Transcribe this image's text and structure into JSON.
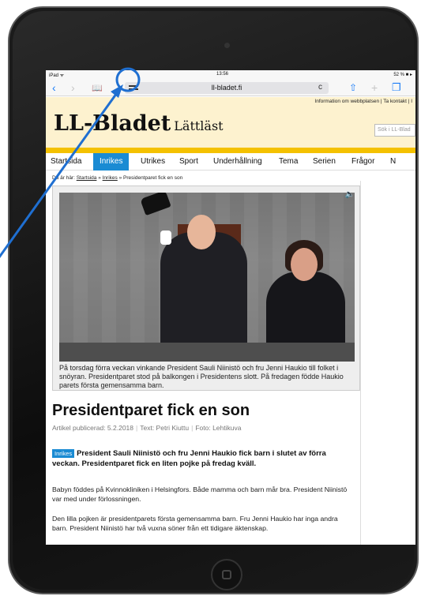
{
  "status": {
    "device": "iPad ᯤ",
    "time": "13:56",
    "battery": "52 % ■ ▸"
  },
  "browser": {
    "back": "‹",
    "forward": "›",
    "bookmarks": "📖",
    "reader": "",
    "url": "ll-bladet.fi",
    "reload": "c",
    "share": "⇧",
    "new_tab": "+",
    "tabs": "❐"
  },
  "site": {
    "info_links": "Information om webbplatsen | Ta kontakt | I",
    "logo": "LL-Bladet",
    "logo_sub": "Lättläst",
    "search_placeholder": "Sök i LL-Blad"
  },
  "nav": [
    "Startsida",
    "Inrikes",
    "Utrikes",
    "Sport",
    "Underhållning",
    "Tema",
    "Serien",
    "Frågor",
    "N"
  ],
  "nav_active": "Inrikes",
  "breadcrumb": {
    "prefix": "Du är här:",
    "home": "Startsida",
    "section": "Inrikes",
    "current": "Presidentparet fick en son",
    "sep": "»"
  },
  "figure": {
    "caption": "På torsdag förra veckan vinkande President Sauli Niinistö och fru Jenni Haukio till folket i snöyran. Presidentparet stod på balkongen i Presidentens slott. På fredagen födde Haukio parets första gemensamma barn.",
    "speaker": "🔈"
  },
  "article": {
    "title": "Presidentparet fick en son",
    "published": "Artikel publicerad: 5.2.2018",
    "author": "Text: Petri Kiuttu",
    "photo": "Foto: Lehtikuva",
    "tag": "Inrikes",
    "lead": "President Sauli Niinistö och fru Jenni Haukio fick barn i slutet av förra veckan. Presidentparet fick en liten pojke på fredag kväll.",
    "p1": "Babyn föddes på Kvinnokliniken i Helsingfors. Både mamma och barn mår bra. President Niinistö var med under förlossningen.",
    "p2": "Den lilla pojken är presidentparets första gemensamma barn. Fru Jenni Haukio har inga andra barn. President Niinistö har två vuxna söner från ett tidigare äktenskap."
  },
  "colors": {
    "accent": "#1a8bd3",
    "header_bg": "#fdf2cf",
    "rule": "#f4c100",
    "arrow": "#1f6fd1"
  }
}
